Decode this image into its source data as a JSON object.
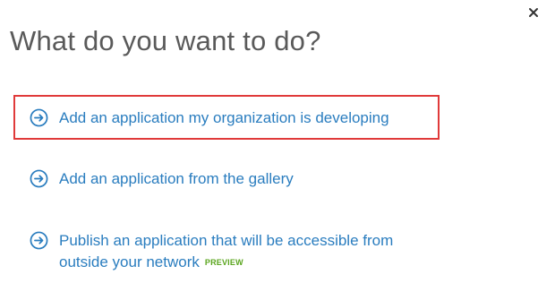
{
  "dialog": {
    "title": "What do you want to do?",
    "close_icon": "close-icon",
    "highlight_color": "#e03a3a",
    "link_color": "#2a7dbf",
    "preview_color": "#5aa51e"
  },
  "options": [
    {
      "icon": "arrow-circle-right-icon",
      "label": "Add an application my organization is developing",
      "highlighted": true
    },
    {
      "icon": "arrow-circle-right-icon",
      "label": "Add an application from the gallery"
    },
    {
      "icon": "arrow-circle-right-icon",
      "label_line1": "Publish an application that will be accessible from",
      "label_line2": "outside your network",
      "badge": "PREVIEW"
    }
  ]
}
